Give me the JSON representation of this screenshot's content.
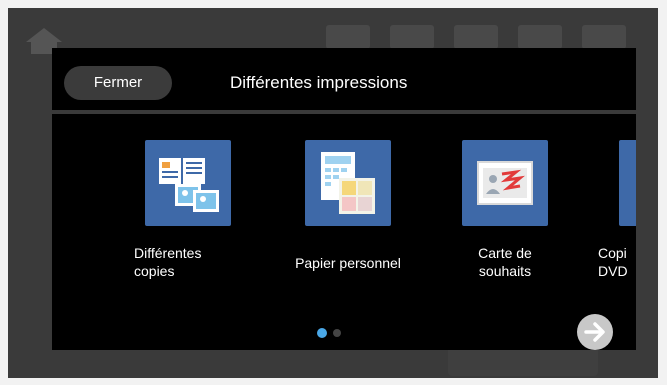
{
  "dialog": {
    "close_label": "Fermer",
    "title": "Différentes impressions"
  },
  "tiles": [
    {
      "label": "Différentes\ncopies",
      "icon": "multi-copies-icon"
    },
    {
      "label": "Papier personnel",
      "icon": "personal-paper-icon"
    },
    {
      "label": "Carte de\nsouhaits",
      "icon": "greeting-card-icon"
    },
    {
      "label": "Copi\nDVD",
      "icon": "dvd-copy-icon"
    }
  ],
  "pagination": {
    "current_page": 1,
    "total_pages": 2
  },
  "colors": {
    "tile_bg": "#3e69a8",
    "active_dot": "#4aa8e8",
    "dialog_bg": "#000000"
  }
}
